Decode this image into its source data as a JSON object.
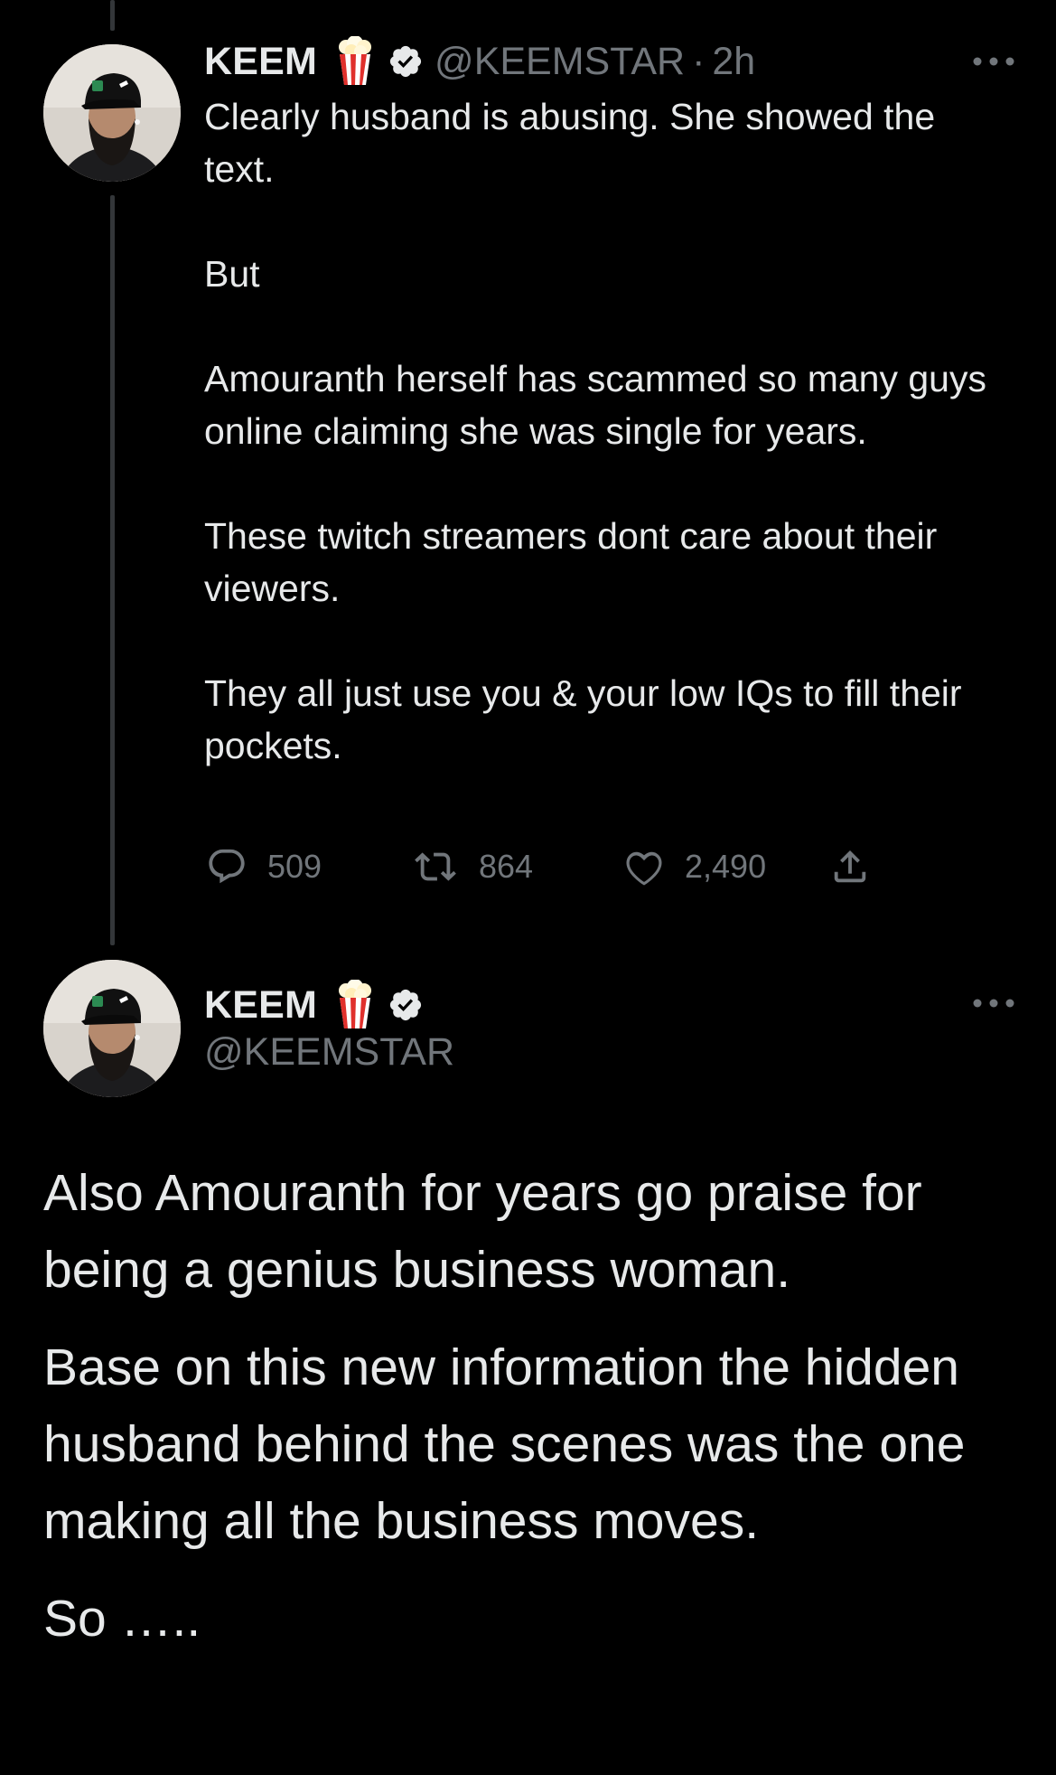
{
  "reply_tweet": {
    "name": "KEEM",
    "handle": "@KEEMSTAR",
    "separator": "·",
    "time": "2h",
    "icons": {
      "name_emoji": "popcorn-icon",
      "verified": "verified-badge-icon",
      "more": "more-options-icon"
    },
    "paragraphs": [
      "Clearly husband is abusing. She showed the text.",
      "But",
      "Amouranth herself has scammed so many guys online claiming she was single for years.",
      "These twitch streamers dont care about their viewers.",
      "They all just use you & your low IQs to fill their pockets."
    ],
    "actions": {
      "replies": "509",
      "retweets": "864",
      "likes": "2,490"
    }
  },
  "main_tweet": {
    "name": "KEEM",
    "handle": "@KEEMSTAR",
    "icons": {
      "name_emoji": "popcorn-icon",
      "verified": "verified-badge-icon",
      "more": "more-options-icon"
    },
    "paragraphs": [
      "Also Amouranth for years go praise for being a genius business woman.",
      "Base on this new information the hidden husband behind the scenes was the one making all the business moves.",
      "So ….."
    ]
  },
  "colors": {
    "background": "#000000",
    "text_primary": "#e7e9ea",
    "text_secondary": "#71767b",
    "thread_line": "#333639"
  }
}
